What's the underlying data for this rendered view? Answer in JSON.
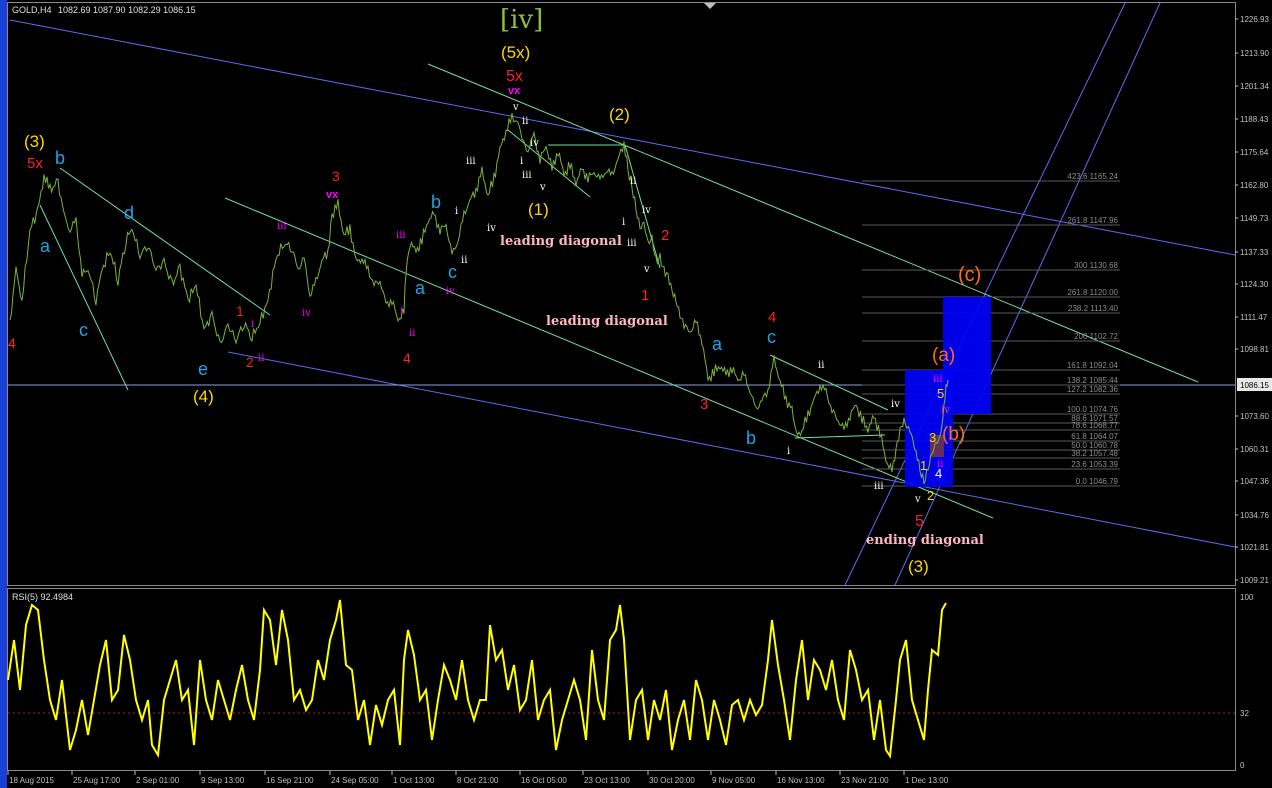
{
  "header": {
    "symbol": "GOLD,H4",
    "ohlc": "1082.69 1087.90 1082.29 1086.15",
    "rsi_label": "RSI(5) 92.4984"
  },
  "price_axis": [
    "1226.93",
    "1213.90",
    "1201.34",
    "1188.43",
    "1175.64",
    "1162.80",
    "1149.73",
    "1137.33",
    "1124.30",
    "1111.47",
    "1098.81",
    "1073.60",
    "1060.31",
    "1047.36",
    "1034.76",
    "1021.81",
    "1009.21"
  ],
  "current_price": "1086.15",
  "rsi_axis": [
    "100",
    "32",
    "0"
  ],
  "time_axis": [
    "18 Aug 2015",
    "25 Aug 17:00",
    "2 Sep 01:00",
    "9 Sep 13:00",
    "16 Sep 21:00",
    "24 Sep 05:00",
    "1 Oct 13:00",
    "8 Oct 21:00",
    "16 Oct 05:00",
    "23 Oct 13:00",
    "30 Oct 20:00",
    "9 Nov 05:00",
    "16 Nov 13:00",
    "23 Nov 21:00",
    "1 Dec 13:00"
  ],
  "fib_levels": [
    "423.6 1165.24",
    "261.8 1147.96",
    "300 1130.68",
    "261.8 1120.00",
    "238.2 1113.40",
    "200 1102.72",
    "161.8 1092.04",
    "138.2 1085.44",
    "127.2 1082.36",
    "100.0 1074.76",
    "88.6 1071.57",
    "78.6 1068.77",
    "61.8 1064.07",
    "50.0 1060.78",
    "38.2 1057.48",
    "23.6 1053.39",
    "0.0 1046.79"
  ],
  "labels": {
    "iv_big": "[iv]",
    "x5_yellow": "(5x)",
    "x5_red": "5x",
    "vx": "vx",
    "wave3_paren": "(3)",
    "wave4_paren": "(4)",
    "wave2_paren": "(2)",
    "wave1_paren": "(1)",
    "wave3_bottom": "(3)",
    "c_paren": "(c)",
    "a_paren": "(a)",
    "b_paren": "(b)",
    "leading_diagonal_1": "leading diagonal",
    "leading_diagonal_2": "leading diagonal",
    "ending_diagonal": "ending diagonal",
    "a": "a",
    "b": "b",
    "c": "c",
    "d": "d",
    "e": "e",
    "n1": "1",
    "n2": "2",
    "n3": "3",
    "n4": "4",
    "n5": "5",
    "i": "i",
    "ii": "ii",
    "iii": "iii",
    "iv": "iv",
    "v": "v"
  },
  "colors": {
    "price_line": "#7bb33a",
    "rsi_line": "#ffff00",
    "channel": "#5a6cf0",
    "trend": "#6fe0a5",
    "fib_box": "#0000ff",
    "red": "#ff2020",
    "yellow": "#ffd700",
    "cyan": "#1fa3e8",
    "magenta": "#ff00ff",
    "orange": "#ff6a1a",
    "pink": "#ffb6c1"
  }
}
